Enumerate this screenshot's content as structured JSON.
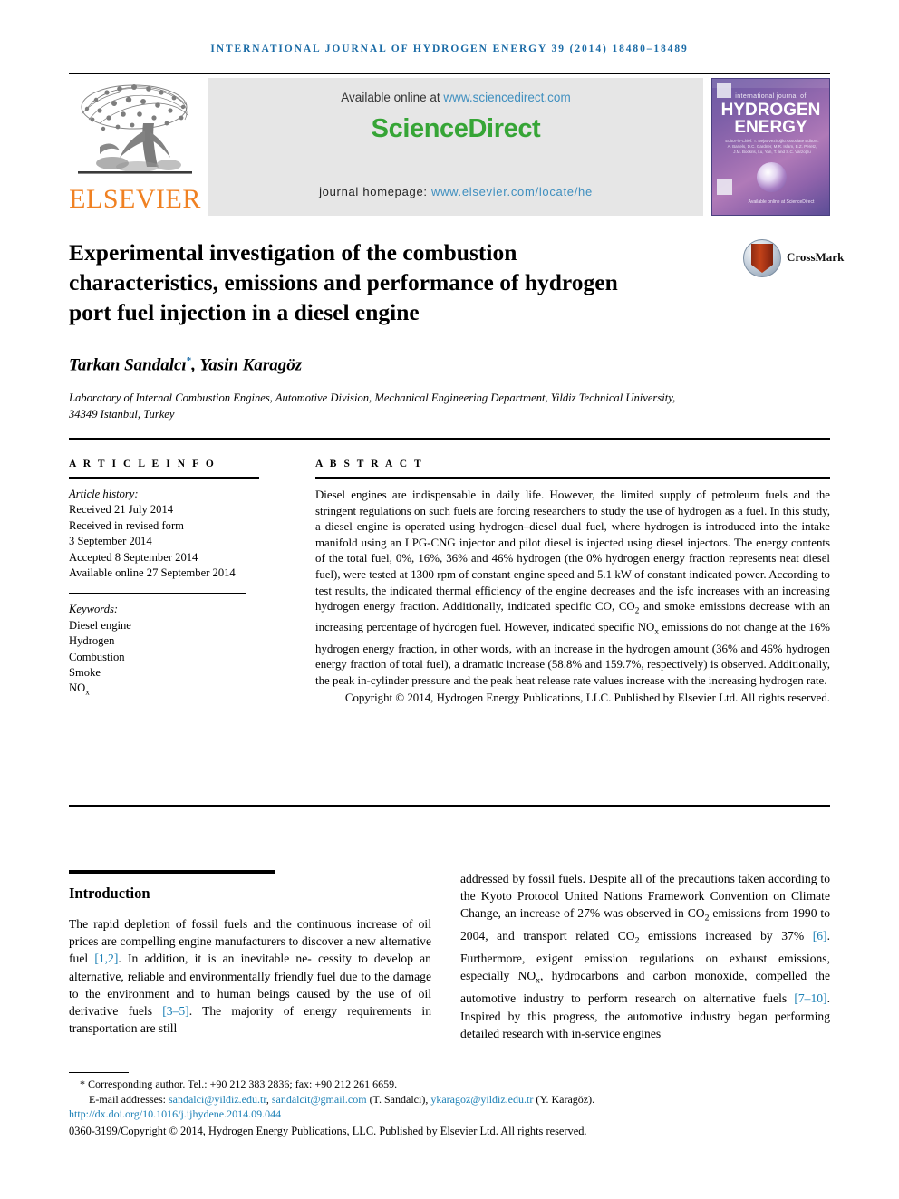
{
  "running_head": "INTERNATIONAL JOURNAL OF HYDROGEN ENERGY 39 (2014) 18480–18489",
  "masthead": {
    "publisher_name": "ELSEVIER",
    "available_prefix": "Available online at ",
    "available_link": "www.sciencedirect.com",
    "sciencedirect_logo": "ScienceDirect",
    "homepage_prefix": "journal homepage: ",
    "homepage_link": "www.elsevier.com/locate/he",
    "cover": {
      "line_top": "international journal of",
      "title_line1": "HYDROGEN",
      "title_line2": "ENERGY",
      "editors": "Editor-in-Chief: T. Nejat Veziroğlu    Associate Editors: A. Bartels, D.C. Gardner, M.R. Islam, B.Z. Peretz, J.M. Bockris, Lu, Yan, T. and S.C. Varzoğlu",
      "footer": "Available online at  ScienceDirect"
    },
    "colors": {
      "link": "#3f8fbf",
      "sciencedirect_green": "#36a536",
      "elsevier_orange": "#F08122",
      "band_gray": "#e6e6e6"
    }
  },
  "article": {
    "title": "Experimental investigation of the combustion characteristics, emissions and performance of hydrogen port fuel injection in a diesel engine",
    "crossmark_label": "CrossMark",
    "authors": "Tarkan Sandalcı",
    "authors_marker": "*",
    "authors_rest": ", Yasin Karagöz",
    "affiliation": "Laboratory of Internal Combustion Engines, Automotive Division, Mechanical Engineering Department, Yildiz Technical University, 34349 Istanbul, Turkey"
  },
  "article_info": {
    "heading": "A R T I C L E   I N F O",
    "history_label": "Article history:",
    "history": [
      "Received 21 July 2014",
      "Received in revised form",
      "3 September 2014",
      "Accepted 8 September 2014",
      "Available online 27 September 2014"
    ],
    "keywords_label": "Keywords:",
    "keywords": [
      "Diesel engine",
      "Hydrogen",
      "Combustion",
      "Smoke",
      "NOx"
    ]
  },
  "abstract": {
    "heading": "A B S T R A C T",
    "body": "Diesel engines are indispensable in daily life. However, the limited supply of petroleum fuels and the stringent regulations on such fuels are forcing researchers to study the use of hydrogen as a fuel. In this study, a diesel engine is operated using hydrogen–diesel dual fuel, where hydrogen is introduced into the intake manifold using an LPG-CNG injector and pilot diesel is injected using diesel injectors. The energy contents of the total fuel, 0%, 16%, 36% and 46% hydrogen (the 0% hydrogen energy fraction represents neat diesel fuel), were tested at 1300 rpm of constant engine speed and 5.1 kW of constant indicated power. According to test results, the indicated thermal efficiency of the engine decreases and the isfc increases with an increasing hydrogen energy fraction. Additionally, indicated specific CO, CO2 and smoke emissions decrease with an increasing percentage of hydrogen fuel. However, indicated specific NOx emissions do not change at the 16% hydrogen energy fraction, in other words, with an increase in the hydrogen amount (36% and 46% hydrogen energy fraction of total fuel), a dramatic increase (58.8% and 159.7%, respectively) is observed. Additionally, the peak in-cylinder pressure and the peak heat release rate values increase with the increasing hydrogen rate.",
    "copyright": "Copyright © 2014, Hydrogen Energy Publications, LLC. Published by Elsevier Ltd. All rights reserved."
  },
  "introduction": {
    "heading": "Introduction",
    "left_paragraph": "The rapid depletion of fossil fuels and the continuous increase of oil prices are compelling engine manufacturers to discover a new alternative fuel [1,2]. In addition, it is an inevitable necessity to develop an alternative, reliable and environmentally friendly fuel due to the damage to the environment and to human beings caused by the use of oil derivative fuels [3–5]. The majority of energy requirements in transportation are still",
    "right_paragraph": "addressed by fossil fuels. Despite all of the precautions taken according to the Kyoto Protocol United Nations Framework Convention on Climate Change, an increase of 27% was observed in CO2 emissions from 1990 to 2004, and transport related CO2 emissions increased by 37% [6]. Furthermore, exigent emission regulations on exhaust emissions, especially NOx, hydrocarbons and carbon monoxide, compelled the automotive industry to perform research on alternative fuels [7–10]. Inspired by this progress, the automotive industry began performing detailed research with in-service engines",
    "refs": {
      "r1": "[1,2]",
      "r2": "[3–5]",
      "r3": "[6]",
      "r4": "[7–10]"
    }
  },
  "footer": {
    "corresponding_marker": "*",
    "corresponding": "Corresponding author. Tel.: +90 212 383 2836; fax: +90 212 261 6659.",
    "email_label": "E-mail addresses:",
    "email1": "sandalci@yildiz.edu.tr",
    "email2": "sandalcit@gmail.com",
    "email_name1": "(T. Sandalcı),",
    "email3": "ykaragoz@yildiz.edu.tr",
    "email_name2": "(Y. Karagöz).",
    "doi": "http://dx.doi.org/10.1016/j.ijhydene.2014.09.044",
    "issn_line": "0360-3199/Copyright © 2014, Hydrogen Energy Publications, LLC. Published by Elsevier Ltd. All rights reserved."
  }
}
